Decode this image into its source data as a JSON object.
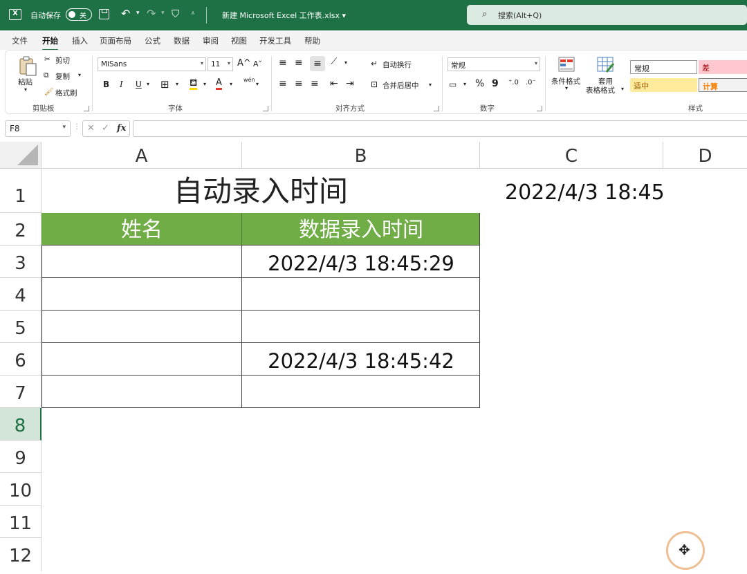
{
  "titlebar": {
    "logo": "X",
    "autosave_label": "自动保存",
    "autosave_state": "关",
    "doc_title": "新建 Microsoft Excel 工作表.xlsx ▾",
    "search_placeholder": "搜索(Alt+Q)"
  },
  "tabs": [
    "文件",
    "开始",
    "插入",
    "页面布局",
    "公式",
    "数据",
    "审阅",
    "视图",
    "开发工具",
    "帮助"
  ],
  "ribbon": {
    "clipboard": {
      "paste": "粘贴",
      "cut": "剪切",
      "copy": "复制",
      "format_painter": "格式刷",
      "label": "剪贴板"
    },
    "font": {
      "name": "MiSans",
      "size": "11",
      "bold": "B",
      "italic": "I",
      "underline": "U",
      "label": "字体",
      "grow": "A^",
      "shrink": "A˅",
      "phonetic": "wén"
    },
    "alignment": {
      "wrap": "自动换行",
      "merge": "合并后居中",
      "label": "对齐方式"
    },
    "number": {
      "format": "常规",
      "percent": "%",
      "comma": "9",
      "label": "数字"
    },
    "styles": {
      "conditional": "条件格式",
      "table_format_1": "套用",
      "table_format_2": "表格格式",
      "normal": "常规",
      "bad": "差",
      "neutral": "适中",
      "calc": "计算",
      "label": "样式"
    }
  },
  "formula_bar": {
    "name_box": "F8",
    "cancel": "✕",
    "enter": "✓",
    "fx": "fx",
    "value": ""
  },
  "columns": [
    "A",
    "B",
    "C",
    "D"
  ],
  "rows": [
    "1",
    "2",
    "3",
    "4",
    "5",
    "6",
    "7",
    "8",
    "9",
    "10",
    "11",
    "12"
  ],
  "cells": {
    "A1": "自动录入时间",
    "C1": "2022/4/3 18:45",
    "A2": "姓名",
    "B2": "数据录入时间",
    "B3": "2022/4/3 18:45:29",
    "B6": "2022/4/3 18:45:42"
  },
  "colors": {
    "excel_green": "#1e7145",
    "header_fill": "#70ad47"
  }
}
